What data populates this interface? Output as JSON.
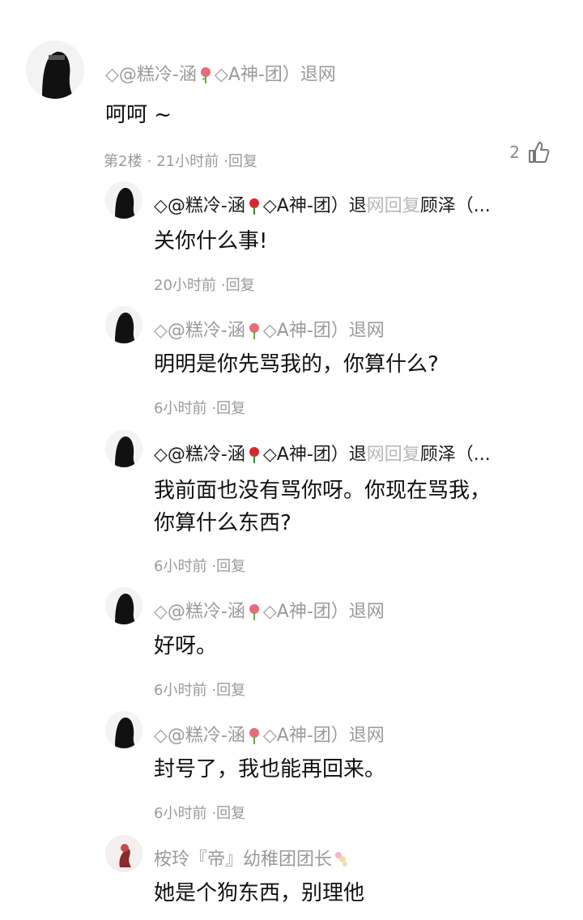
{
  "colors": {
    "name_gray": "#9a9a9a",
    "name_faint": "#b8b8b8",
    "text_dark": "#111111",
    "meta_gray": "#9a9a9a",
    "rose_red": "#e23b3b"
  },
  "top_comment": {
    "author": "◇@糕冷-涵",
    "author_suffix": "◇A神-团）退网",
    "text": "呵呵 ~",
    "floor": "第2楼",
    "time": "21小时前",
    "reply": "·回复",
    "likes": "2",
    "icons": [
      "avatar",
      "rose-icon",
      "thumbs-up-icon"
    ]
  },
  "replies": [
    {
      "author": "◇@糕冷-涵",
      "author_suffix": "◇A神-团）退",
      "faint_tail": "网回复",
      "target": "顾泽（...",
      "text": "关你什么事!",
      "time": "20小时前",
      "reply": "·回复"
    },
    {
      "author": "◇@糕冷-涵",
      "author_suffix": "◇A神-团）退网",
      "text": "明明是你先骂我的，你算什么?",
      "time": "6小时前",
      "reply": "·回复"
    },
    {
      "author": "◇@糕冷-涵",
      "author_suffix": "◇A神-团）退",
      "faint_tail": "网回复",
      "target": "顾泽（...",
      "text_line1": "我前面也没有骂你呀。你现在骂我，",
      "text_line2": "你算什么东西?",
      "time": "6小时前",
      "reply": "·回复"
    },
    {
      "author": "◇@糕冷-涵",
      "author_suffix": "◇A神-团）退网",
      "text": "好呀。",
      "time": "6小时前",
      "reply": "·回复"
    },
    {
      "author": "◇@糕冷-涵",
      "author_suffix": "◇A神-团）退网",
      "text": "封号了，我也能再回来。",
      "time": "6小时前",
      "reply": "·回复"
    },
    {
      "author": "桉玲『帝』幼稚团团长",
      "text": "她是个狗东西，别理他"
    }
  ]
}
